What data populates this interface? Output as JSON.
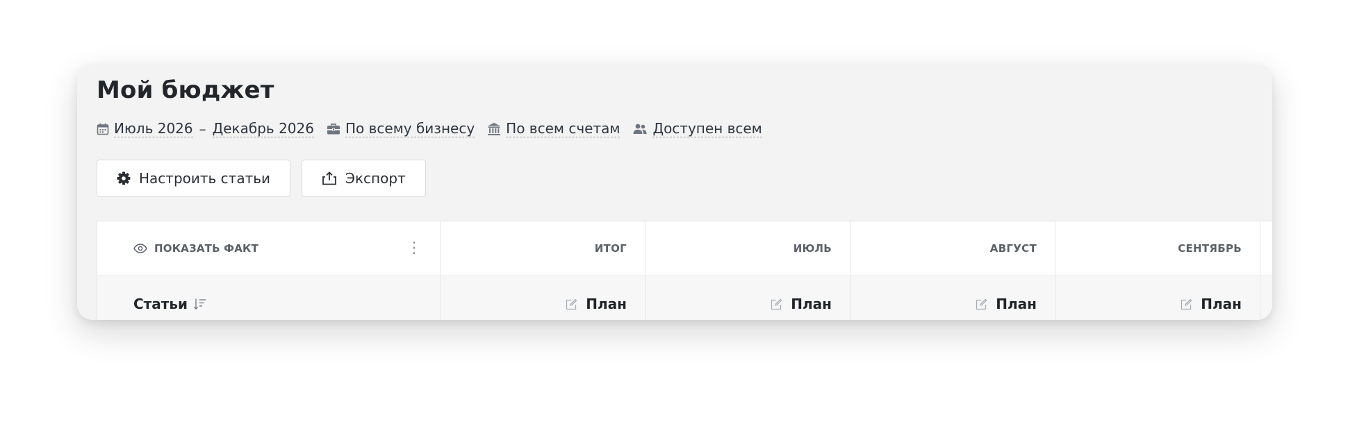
{
  "budget": {
    "title": "Мой бюджет",
    "filters": {
      "period_from": "Июль 2026",
      "period_separator": "–",
      "period_to": "Декабрь 2026",
      "business": "По всему бизнесу",
      "accounts": "По всем счетам",
      "access": "Доступен всем"
    },
    "buttons": {
      "configure": "Настроить статьи",
      "export": "Экспорт"
    },
    "icons": {
      "calendar": "calendar-icon",
      "business": "briefcase-icon",
      "accounts": "bank-icon",
      "access": "users-icon",
      "configure": "gear-icon",
      "export": "share-icon",
      "show_fact": "eye-icon",
      "menu": "kebab-menu-icon",
      "sort": "sort-icon",
      "plan": "edit-icon"
    }
  },
  "table": {
    "show_fact_label": "ПОКАЗАТЬ ФАКТ",
    "columns": [
      "ИТОГ",
      "ИЮЛЬ",
      "АВГУСТ",
      "СЕНТЯБРЬ"
    ],
    "articles_label": "Статьи",
    "plan_labels": [
      "План",
      "План",
      "План",
      "План"
    ]
  },
  "colors": {
    "card_bg": "#f3f3f3",
    "header_text": "#5b6068",
    "icon_grey": "#6f7580"
  }
}
